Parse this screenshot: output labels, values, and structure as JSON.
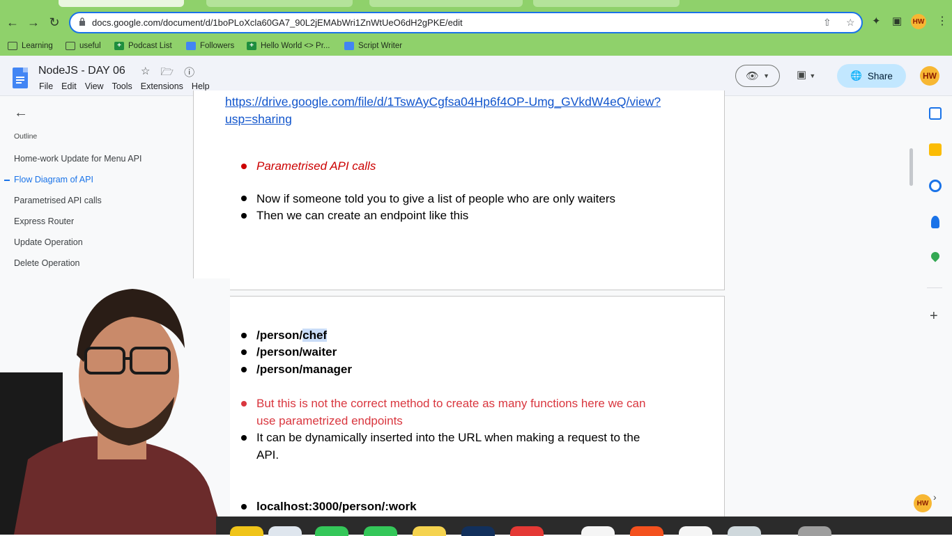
{
  "browser": {
    "url": "docs.google.com/document/d/1boPLoXcla60GA7_90L2jEMAbWri1ZnWtUeO6dH2gPKE/edit",
    "bookmarks": [
      "Learning",
      "useful",
      "Podcast List",
      "Followers",
      "Hello World <> Pr...",
      "Script Writer"
    ]
  },
  "docs": {
    "title": "NodeJS - DAY 06",
    "menu": [
      "File",
      "Edit",
      "View",
      "Tools",
      "Extensions",
      "Help"
    ],
    "share_label": "Share",
    "avatar_initials": "HW"
  },
  "outline": {
    "title": "Outline",
    "items": [
      "Home-work Update for Menu API",
      "Flow Diagram of API",
      "Parametrised API calls",
      "Express Router",
      "Update Operation",
      "Delete Operation"
    ],
    "active_index": 1
  },
  "document": {
    "link_line1": "https://drive.google.com/file/d/1TswAyCgfsa04Hp6f4OP-Umg_GVkdW4eQ/view?",
    "link_line2": "usp=sharing",
    "heading_parametrised": "Parametrised API calls",
    "para1": "Now if someone told you to give a list of people who are only waiters",
    "para2": "Then we can create an endpoint like this",
    "ep_chef_a": "/person/",
    "ep_chef_b": "chef",
    "ep_waiter": "/person/waiter",
    "ep_manager": "/person/manager",
    "warn_line1": "But this is not the correct method to create as many functions here we can",
    "warn_line2": "use parametrized endpoints",
    "dyn_line1": "It can be dynamically inserted into the URL when making a request to the",
    "dyn_line2": "API.",
    "ep_work": "localhost:3000/person/:work"
  },
  "colors": {
    "browser_green": "#8fd16b",
    "accent_blue": "#1a73e8",
    "link_blue": "#1155cc",
    "heading_red": "#cc0000",
    "share_bg": "#c2e7ff"
  }
}
